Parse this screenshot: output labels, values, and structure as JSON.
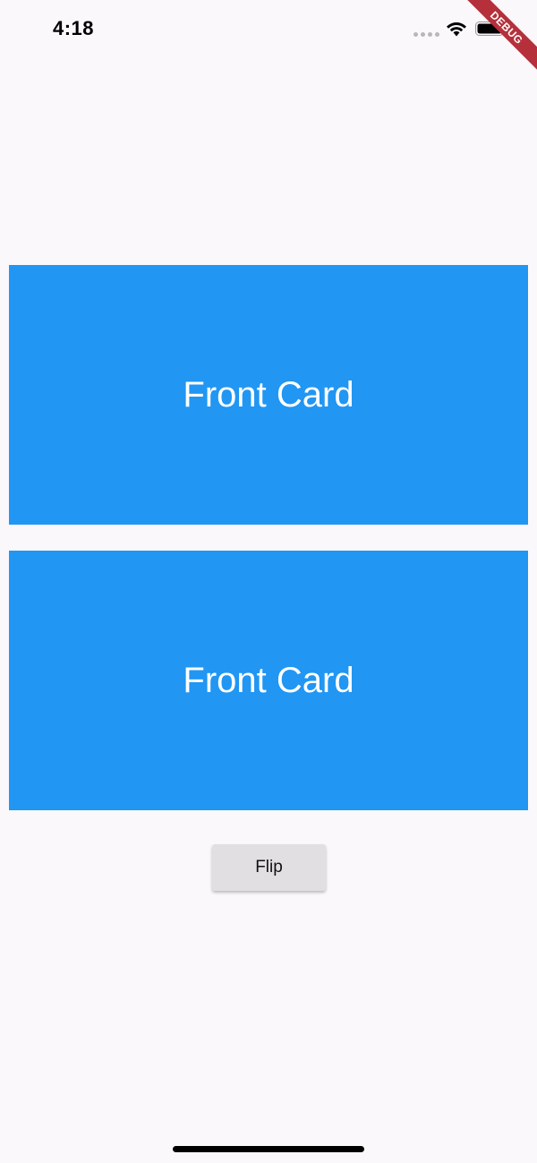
{
  "status_bar": {
    "time": "4:18"
  },
  "debug_banner": {
    "label": "DEBUG"
  },
  "cards": [
    {
      "label": "Front Card",
      "color": "#2196f3"
    },
    {
      "label": "Front Card",
      "color": "#2196f3"
    }
  ],
  "flip_button": {
    "label": "Flip"
  },
  "icons": [
    "wifi-icon",
    "battery-icon",
    "signal-dots-icon"
  ]
}
